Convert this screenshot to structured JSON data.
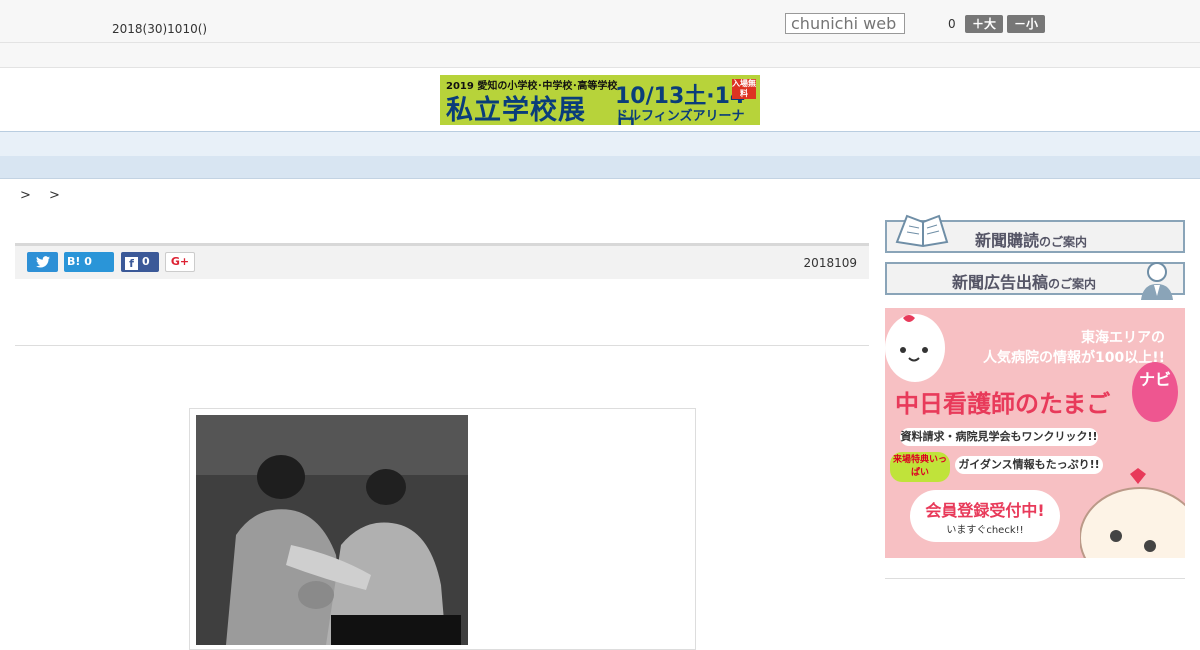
{
  "header": {
    "date": "2018(30)1010()",
    "search_placeholder": "chunichi web",
    "counter": "0",
    "font_up_label": "＋大",
    "font_down_label": "－小"
  },
  "banner": {
    "line1": "2019 愛知の小学校･中学校･高等学校",
    "title": "私立学校展",
    "dates": "10/13土·14日",
    "venue": "ドルフィンズアリーナ",
    "free": "入場無料"
  },
  "nav": {
    "items": [
      "",
      "",
      "",
      "",
      "",
      "",
      "",
      "",
      ""
    ]
  },
  "breadcrumb": [
    ">",
    ">"
  ],
  "share": {
    "hatena_label": "B! 0",
    "facebook_count": "0",
    "gplus_label": "G+",
    "publish_date": "2018109"
  },
  "sidebar": {
    "subscribe_main": "新聞購読",
    "subscribe_sub": "のご案内",
    "advertise_main": "新聞広告出稿",
    "advertise_sub": "のご案内",
    "ad": {
      "line1": "東海エリアの",
      "line2": "人気病院の情報が100以上!!",
      "title": "中日看護師のたまご",
      "badge": "ナビ",
      "info1": "資料請求・病院見学会もワンクリック!!",
      "info2": "ガイダンス情報もたっぷり!!",
      "tag": "来場特典いっぱい",
      "cta": "会員登録受付中!",
      "cta_sub": "いますぐcheck!!"
    }
  }
}
